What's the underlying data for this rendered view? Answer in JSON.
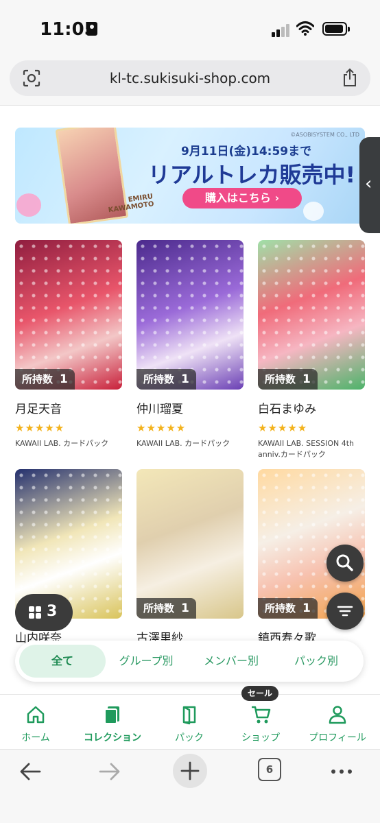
{
  "status_bar": {
    "time": "11:05"
  },
  "browser": {
    "url": "kl-tc.sukisuki-shop.com",
    "tab_count": "6"
  },
  "banner": {
    "copyright": "©ASOBISYSTEM CO., LTD",
    "card_name": "EMIRU KAWAMOTO",
    "date_text": "9月11日(金)14:59まで",
    "headline": "リアルトレカ販売中!",
    "cta": "購入はこちら ›"
  },
  "owned_label": "所持数",
  "cards": [
    {
      "name": "月足天音",
      "count": "1",
      "stars": "★★★★★",
      "pack": "KAWAII LAB. カードパック",
      "color": "#c2263c"
    },
    {
      "name": "仲川瑠夏",
      "count": "1",
      "stars": "★★★★★",
      "pack": "KAWAII LAB. カードパック",
      "color": "#6a3fb4"
    },
    {
      "name": "白石まゆみ",
      "count": "1",
      "stars": "★★★★★",
      "pack": "KAWAII LAB. SESSION 4th anniv.カードパック",
      "color": "#3fae5e"
    },
    {
      "name": "山内咲奈",
      "count": "",
      "stars": "",
      "pack": "",
      "color": "#2e3e8c"
    },
    {
      "name": "古澤里紗",
      "count": "1",
      "stars": "",
      "pack": "",
      "color": "#d8c68a"
    },
    {
      "name": "鎮西寿々歌",
      "count": "1",
      "stars": "",
      "pack": "",
      "color": "#f2a34c"
    }
  ],
  "collection_count": "3",
  "filter_tabs": [
    "全て",
    "グループ別",
    "メンバー別",
    "パック別"
  ],
  "app_nav": {
    "sale_badge": "セール",
    "items": [
      "ホーム",
      "コレクション",
      "パック",
      "ショップ",
      "プロフィール"
    ]
  },
  "colors": {
    "accent": "#1f9a5c",
    "cta": "#f04a88",
    "headline": "#1f3a96"
  },
  "icons": [
    "scan-icon",
    "share-icon",
    "search-icon",
    "filter-icon",
    "grid-icon",
    "home-icon",
    "collection-icon",
    "pack-icon",
    "cart-icon",
    "profile-icon",
    "back-icon",
    "forward-icon",
    "plus-icon",
    "tabs-icon",
    "more-icon"
  ]
}
